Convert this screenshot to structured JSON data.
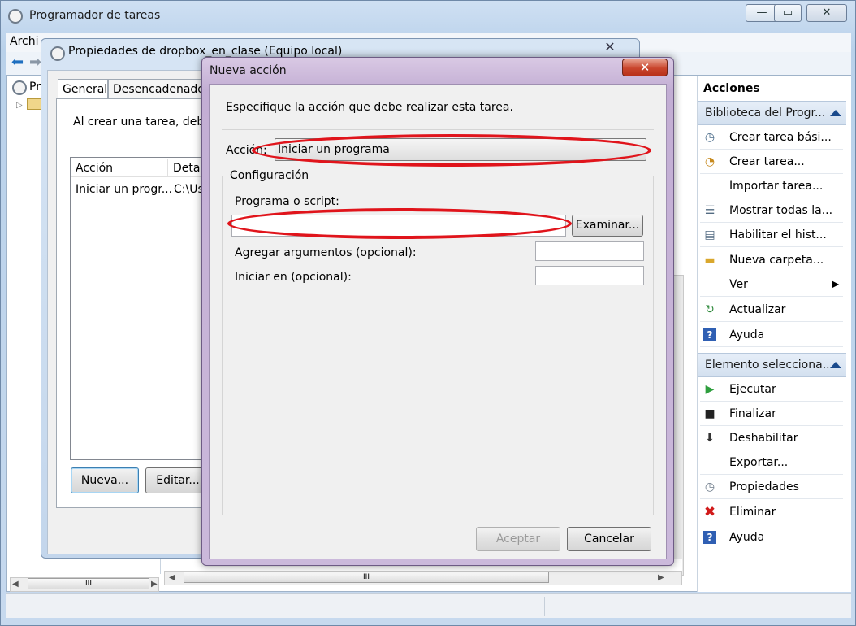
{
  "main_window": {
    "title": "Programador de tareas",
    "menu_file": "Archi",
    "tree_item": "Pr",
    "minimize": "—",
    "maximize": "▭",
    "close": "✕"
  },
  "properties_window": {
    "title": "Propiedades de dropbox_en_clase (Equipo local)",
    "close": "✕",
    "tabs": [
      "General",
      "Desencadenado"
    ],
    "intro": "Al crear una tarea, debe",
    "list": {
      "columns": [
        "Acción",
        "Detal"
      ],
      "rows": [
        {
          "accion": "Iniciar un progr...",
          "detalle": "C:\\Us"
        }
      ]
    },
    "buttons": {
      "new": "Nueva...",
      "edit": "Editar..."
    }
  },
  "dialog": {
    "title": "Nueva acción",
    "close": "✕",
    "instruction": "Especifique la acción que debe realizar esta tarea.",
    "action_label": "Acción:",
    "action_value": "Iniciar un programa",
    "config_legend": "Configuración",
    "program_label": "Programa o script:",
    "program_value": "",
    "browse_button": "Examinar...",
    "args_label": "Agregar argumentos (opcional):",
    "args_value": "",
    "start_label": "Iniciar en (opcional):",
    "start_value": "",
    "ok_button": "Aceptar",
    "cancel_button": "Cancelar",
    "annotation_color": "#e0141b"
  },
  "actions_panel": {
    "title": "Acciones",
    "group1": "Biblioteca del Progr...",
    "group1_items": [
      {
        "label": "Crear tarea bási...",
        "icon": "basic-task-icon"
      },
      {
        "label": "Crear tarea...",
        "icon": "task-icon"
      },
      {
        "label": "Importar tarea...",
        "icon": ""
      },
      {
        "label": "Mostrar todas la...",
        "icon": "list-icon"
      },
      {
        "label": "Habilitar el hist...",
        "icon": "history-icon"
      },
      {
        "label": "Nueva carpeta...",
        "icon": "folder-icon"
      },
      {
        "label": "Ver",
        "icon": ""
      },
      {
        "label": "Actualizar",
        "icon": "refresh-icon"
      },
      {
        "label": "Ayuda",
        "icon": "help-icon"
      }
    ],
    "group2": "Elemento selecciona...",
    "group2_items": [
      {
        "label": "Ejecutar",
        "icon": "run-icon"
      },
      {
        "label": "Finalizar",
        "icon": "stop-icon"
      },
      {
        "label": "Deshabilitar",
        "icon": "disable-icon"
      },
      {
        "label": "Exportar...",
        "icon": ""
      },
      {
        "label": "Propiedades",
        "icon": "properties-icon"
      },
      {
        "label": "Eliminar",
        "icon": "delete-icon"
      },
      {
        "label": "Ayuda",
        "icon": "help-icon"
      }
    ]
  },
  "scroll_marker": "III"
}
